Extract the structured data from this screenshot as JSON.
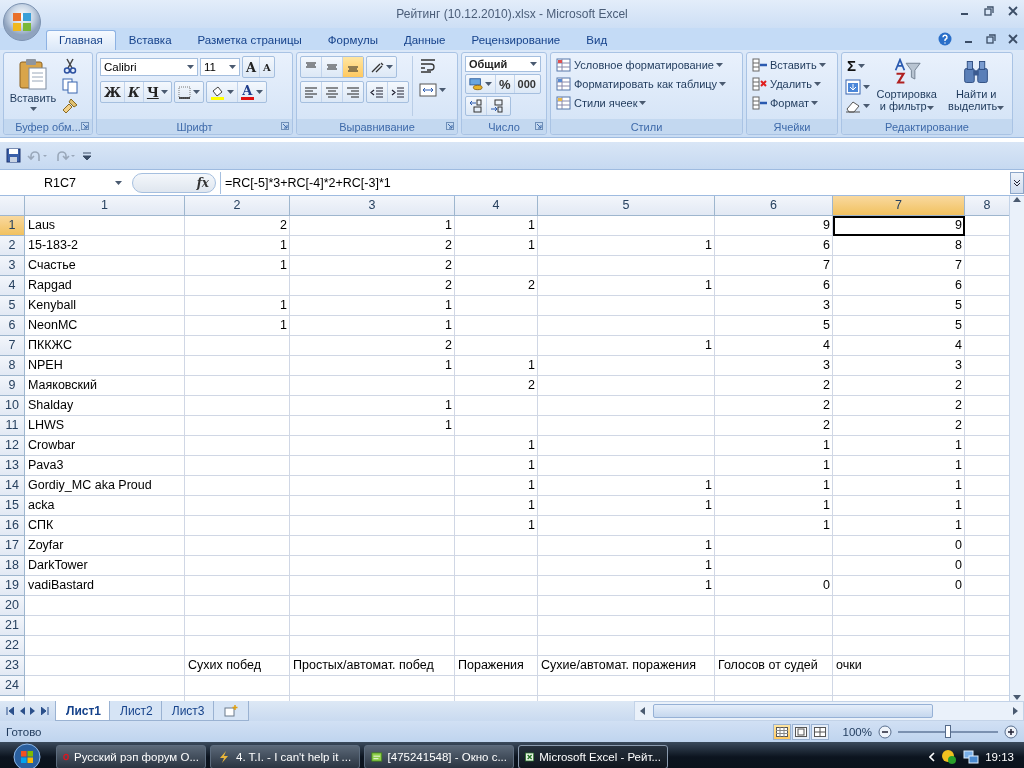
{
  "window": {
    "title": "Рейтинг (10.12.2010).xlsx - Microsoft Excel"
  },
  "ribbon_tabs": [
    {
      "label": "Главная",
      "selected": true
    },
    {
      "label": "Вставка",
      "selected": false
    },
    {
      "label": "Разметка страницы",
      "selected": false
    },
    {
      "label": "Формулы",
      "selected": false
    },
    {
      "label": "Данные",
      "selected": false
    },
    {
      "label": "Рецензирование",
      "selected": false
    },
    {
      "label": "Вид",
      "selected": false
    }
  ],
  "clipboard": {
    "paste": "Вставить",
    "label": "Буфер обм..."
  },
  "font": {
    "family": "Calibri",
    "size": "11",
    "grow": "A",
    "shrink": "A",
    "bold": "Ж",
    "italic": "К",
    "underline": "Ч",
    "color_letter": "A",
    "label": "Шрифт"
  },
  "alignment": {
    "vertical_buttons": [
      {
        "selected": false
      },
      {
        "selected": false
      },
      {
        "selected": true
      }
    ],
    "label": "Выравнивание"
  },
  "number": {
    "format": "Общий",
    "percent": "%",
    "thousands": "000",
    "label": "Число"
  },
  "styles": {
    "items": [
      "Условное форматирование",
      "Форматировать как таблицу",
      "Стили ячеек"
    ],
    "label": "Стили"
  },
  "cells": {
    "items": [
      "Вставить",
      "Удалить",
      "Формат"
    ],
    "label": "Ячейки"
  },
  "editing": {
    "sum": "Σ",
    "sort": "Сортировка и фильтр",
    "find": "Найти и выделить",
    "label": "Редактирование"
  },
  "formula_bar": {
    "name_box": "R1C7",
    "fx": "fx",
    "formula": "=RC[-5]*3+RC[-4]*2+RC[-3]*1"
  },
  "columns": [
    {
      "label": "1",
      "selected": false
    },
    {
      "label": "2",
      "selected": false
    },
    {
      "label": "3",
      "selected": false
    },
    {
      "label": "4",
      "selected": false
    },
    {
      "label": "5",
      "selected": false
    },
    {
      "label": "6",
      "selected": false
    },
    {
      "label": "7",
      "selected": true
    },
    {
      "label": "8",
      "selected": false
    }
  ],
  "rows": [
    {
      "num": "1",
      "selected": true,
      "kind": "data",
      "cells": [
        "Laus",
        "2",
        "1",
        "1",
        null,
        "9",
        "9"
      ]
    },
    {
      "num": "2",
      "selected": false,
      "kind": "data",
      "cells": [
        "15-183-2",
        "1",
        "2",
        "1",
        "1",
        "6",
        "8"
      ]
    },
    {
      "num": "3",
      "selected": false,
      "kind": "data",
      "cells": [
        "Счастье",
        "1",
        "2",
        null,
        null,
        "7",
        "7"
      ]
    },
    {
      "num": "4",
      "selected": false,
      "kind": "data",
      "cells": [
        "Rapgad",
        null,
        "2",
        "2",
        "1",
        "6",
        "6"
      ]
    },
    {
      "num": "5",
      "selected": false,
      "kind": "data",
      "cells": [
        "Kenyball",
        "1",
        "1",
        null,
        null,
        "3",
        "5"
      ]
    },
    {
      "num": "6",
      "selected": false,
      "kind": "data",
      "cells": [
        "NeonMC",
        "1",
        "1",
        null,
        null,
        "5",
        "5"
      ]
    },
    {
      "num": "7",
      "selected": false,
      "kind": "data",
      "cells": [
        "ПККЖС",
        null,
        "2",
        null,
        "1",
        "4",
        "4"
      ]
    },
    {
      "num": "8",
      "selected": false,
      "kind": "data",
      "cells": [
        "NPEH",
        null,
        "1",
        "1",
        null,
        "3",
        "3"
      ]
    },
    {
      "num": "9",
      "selected": false,
      "kind": "data",
      "cells": [
        "Маяковский",
        null,
        null,
        "2",
        null,
        "2",
        "2"
      ]
    },
    {
      "num": "10",
      "selected": false,
      "kind": "data",
      "cells": [
        "Shalday",
        null,
        "1",
        null,
        null,
        "2",
        "2"
      ]
    },
    {
      "num": "11",
      "selected": false,
      "kind": "data",
      "cells": [
        "LHWS",
        null,
        "1",
        null,
        null,
        "2",
        "2"
      ]
    },
    {
      "num": "12",
      "selected": false,
      "kind": "data",
      "cells": [
        "Crowbar",
        null,
        null,
        "1",
        null,
        "1",
        "1"
      ]
    },
    {
      "num": "13",
      "selected": false,
      "kind": "data",
      "cells": [
        "Pava3",
        null,
        null,
        "1",
        null,
        "1",
        "1"
      ]
    },
    {
      "num": "14",
      "selected": false,
      "kind": "data",
      "cells": [
        "Gordiy_MC aka Proud",
        null,
        null,
        "1",
        "1",
        "1",
        "1"
      ]
    },
    {
      "num": "15",
      "selected": false,
      "kind": "data",
      "cells": [
        "acka",
        null,
        null,
        "1",
        "1",
        "1",
        "1"
      ]
    },
    {
      "num": "16",
      "selected": false,
      "kind": "data",
      "cells": [
        "СПК",
        null,
        null,
        "1",
        null,
        "1",
        "1"
      ]
    },
    {
      "num": "17",
      "selected": false,
      "kind": "data",
      "cells": [
        "Zoyfar",
        null,
        null,
        null,
        "1",
        null,
        "0"
      ]
    },
    {
      "num": "18",
      "selected": false,
      "kind": "data",
      "cells": [
        "DarkTower",
        null,
        null,
        null,
        "1",
        null,
        "0"
      ]
    },
    {
      "num": "19",
      "selected": false,
      "kind": "data",
      "cells": [
        "vadiBastard",
        null,
        null,
        null,
        "1",
        "0",
        "0"
      ]
    },
    {
      "num": "20",
      "selected": false,
      "kind": "data"
    },
    {
      "num": "21",
      "selected": false,
      "kind": "data"
    },
    {
      "num": "22",
      "selected": false,
      "kind": "data"
    },
    {
      "num": "23",
      "selected": false,
      "kind": "labels",
      "cells": [
        null,
        "Сухих побед",
        "Простых/автомат. побед",
        "Поражения",
        "Сухие/автомат. поражения",
        "Голосов от судей",
        "очки"
      ]
    },
    {
      "num": "24",
      "selected": false,
      "kind": "data"
    }
  ],
  "sheet_tabs": [
    {
      "label": "Лист1",
      "selected": true
    },
    {
      "label": "Лист2",
      "selected": false
    },
    {
      "label": "Лист3",
      "selected": false
    }
  ],
  "status_bar": {
    "ready": "Готово",
    "views": [
      {
        "selected": true
      },
      {
        "selected": false
      },
      {
        "selected": false
      }
    ],
    "zoom": "100%",
    "zoom_slider": {
      "level": 0.5
    }
  },
  "taskbar": {
    "items": [
      {
        "label": "Русский рэп форум О...",
        "kind": "browser",
        "selected": false
      },
      {
        "label": "4. T.I. - I can't help it ...",
        "kind": "player",
        "selected": false
      },
      {
        "label": "[475241548] - Окно с...",
        "kind": "messenger",
        "selected": false
      },
      {
        "label": "Microsoft Excel - Рейт...",
        "kind": "spreadsheet",
        "selected": true
      }
    ],
    "clock": "19:13"
  }
}
